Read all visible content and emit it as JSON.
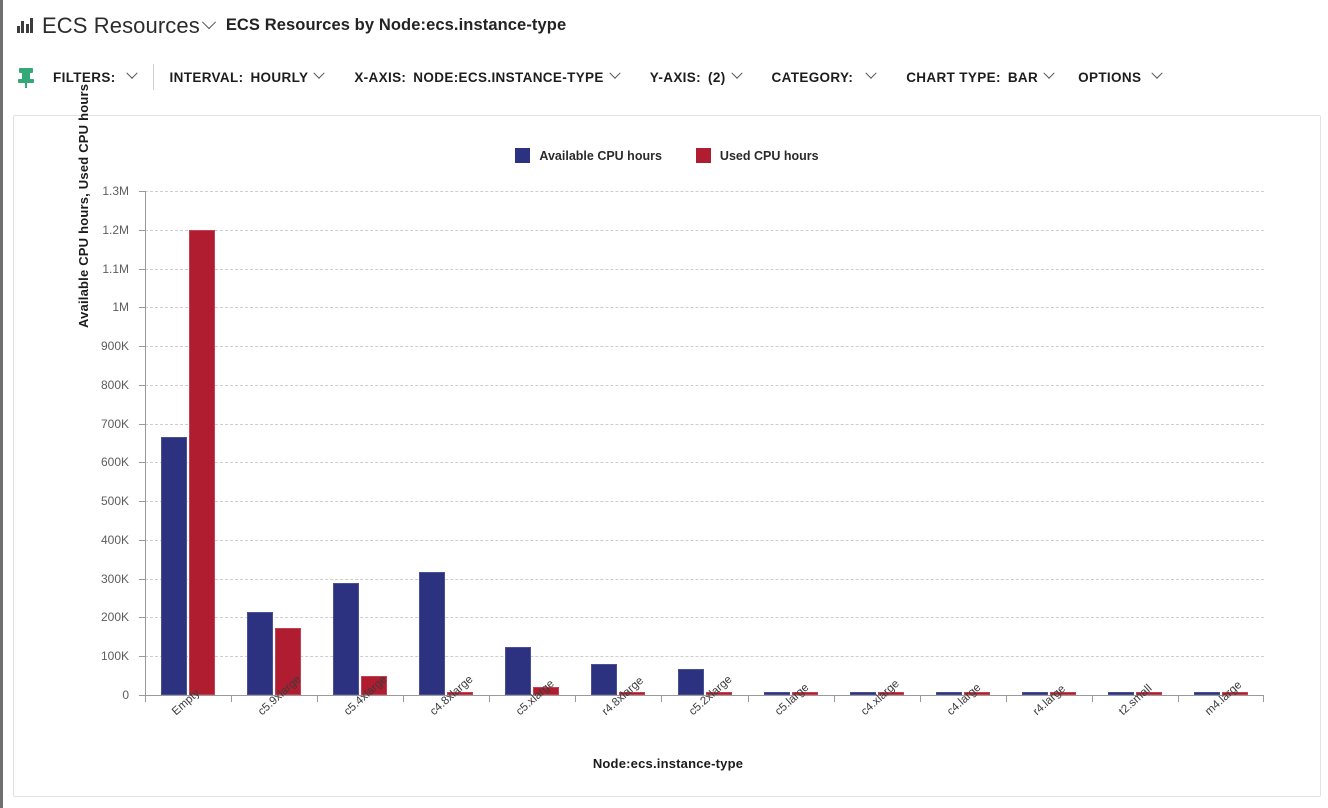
{
  "header": {
    "icon": "bar-chart-icon",
    "dashboard_title": "ECS Resources",
    "dashboard_chevron": "chevron-down-icon",
    "widget_title": "ECS Resources by Node:ecs.instance-type"
  },
  "toolbar": {
    "pin_icon": "pushpin-icon",
    "filters_label": "FILTERS:",
    "interval_label": "INTERVAL:",
    "interval_value": "HOURLY",
    "xaxis_label": "X-AXIS:",
    "xaxis_value": "NODE:ECS.INSTANCE-TYPE",
    "yaxis_label": "Y-AXIS:",
    "yaxis_value": "(2)",
    "category_label": "CATEGORY:",
    "category_value": "",
    "charttype_label": "CHART TYPE:",
    "charttype_value": "BAR",
    "options_label": "OPTIONS",
    "chevron": "chevron-down-icon"
  },
  "colors": {
    "series_available": "#2c3180",
    "series_used": "#b01d30",
    "pin": "#34a877",
    "grid": "#cdcdcd",
    "axis": "#9a9a9a"
  },
  "chart_data": {
    "type": "bar",
    "title": "ECS Resources by Node:ecs.instance-type",
    "xlabel": "Node:ecs.instance-type",
    "ylabel": "Available CPU hours, Used CPU hours",
    "legend_position": "top-center",
    "grid": true,
    "ylim": [
      0,
      1300000
    ],
    "ytick_values": [
      0,
      100000,
      200000,
      300000,
      400000,
      500000,
      600000,
      700000,
      800000,
      900000,
      1000000,
      1100000,
      1200000,
      1300000
    ],
    "ytick_labels": [
      "0",
      "100K",
      "200K",
      "300K",
      "400K",
      "500K",
      "600K",
      "700K",
      "800K",
      "900K",
      "1M",
      "1.1M",
      "1.2M",
      "1.3M"
    ],
    "categories": [
      "Empty",
      "c5.9xlarge",
      "c5.4xlarge",
      "c4.8xlarge",
      "c5.xlarge",
      "r4.8xlarge",
      "c5.2xlarge",
      "c5.large",
      "c4.xlarge",
      "c4.large",
      "r4.large",
      "t2.small",
      "m4.large"
    ],
    "series": [
      {
        "name": "Available CPU hours",
        "color": "#2c3180",
        "values": [
          665000,
          213000,
          290000,
          318000,
          123000,
          80000,
          68000,
          5000,
          5000,
          5000,
          4000,
          4000,
          4000
        ]
      },
      {
        "name": "Used CPU hours",
        "color": "#b01d30",
        "values": [
          1200000,
          173000,
          48000,
          5000,
          20000,
          5000,
          5000,
          5000,
          5000,
          5000,
          4000,
          4000,
          4000
        ]
      }
    ]
  }
}
